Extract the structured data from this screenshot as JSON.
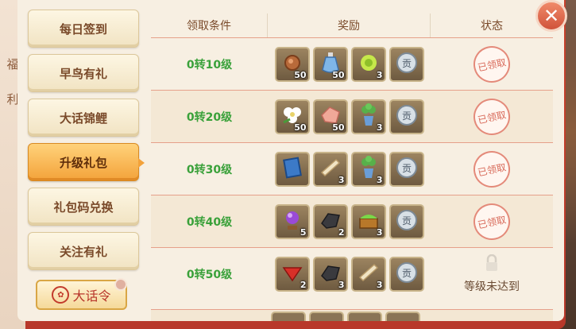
{
  "side_label": [
    "福",
    "利"
  ],
  "menu": [
    {
      "label": "每日签到",
      "active": false
    },
    {
      "label": "早鸟有礼",
      "active": false
    },
    {
      "label": "大话锦鲤",
      "active": false
    },
    {
      "label": "升级礼包",
      "active": true
    },
    {
      "label": "礼包码兑换",
      "active": false
    },
    {
      "label": "关注有礼",
      "active": false
    }
  ],
  "dahua_button": {
    "label": "大话令"
  },
  "table": {
    "headers": [
      "领取条件",
      "奖励",
      "状态"
    ],
    "rows": [
      {
        "condition": "0转10级",
        "rewards": [
          {
            "icon": "copper-coin-icon",
            "count": "50"
          },
          {
            "icon": "blue-potion-bottle-icon",
            "count": "50"
          },
          {
            "icon": "green-flower-icon",
            "count": "3"
          },
          {
            "icon": "silver-token-icon",
            "count": ""
          }
        ],
        "status": "已领取",
        "claimed": true
      },
      {
        "condition": "0转20级",
        "rewards": [
          {
            "icon": "white-flower-icon",
            "count": "50"
          },
          {
            "icon": "pink-crystal-icon",
            "count": "50"
          },
          {
            "icon": "potted-plant-icon",
            "count": "3"
          },
          {
            "icon": "silver-token-icon",
            "count": ""
          }
        ],
        "status": "已领取",
        "claimed": true
      },
      {
        "condition": "0转30级",
        "rewards": [
          {
            "icon": "blue-book-icon",
            "count": ""
          },
          {
            "icon": "scroll-icon",
            "count": "3"
          },
          {
            "icon": "potted-plant-icon",
            "count": "3"
          },
          {
            "icon": "silver-token-icon",
            "count": ""
          }
        ],
        "status": "已领取",
        "claimed": true
      },
      {
        "condition": "0转40级",
        "rewards": [
          {
            "icon": "purple-orb-icon",
            "count": "5"
          },
          {
            "icon": "dark-stone-icon",
            "count": "2"
          },
          {
            "icon": "treasure-chest-icon",
            "count": "3"
          },
          {
            "icon": "silver-token-icon",
            "count": ""
          }
        ],
        "status": "已领取",
        "claimed": true
      },
      {
        "condition": "0转50级",
        "rewards": [
          {
            "icon": "red-gem-icon",
            "count": "2"
          },
          {
            "icon": "dark-stone-icon",
            "count": "3"
          },
          {
            "icon": "scroll-icon",
            "count": "3"
          },
          {
            "icon": "silver-token-icon",
            "count": ""
          }
        ],
        "status": "等级未达到",
        "claimed": false
      }
    ]
  }
}
